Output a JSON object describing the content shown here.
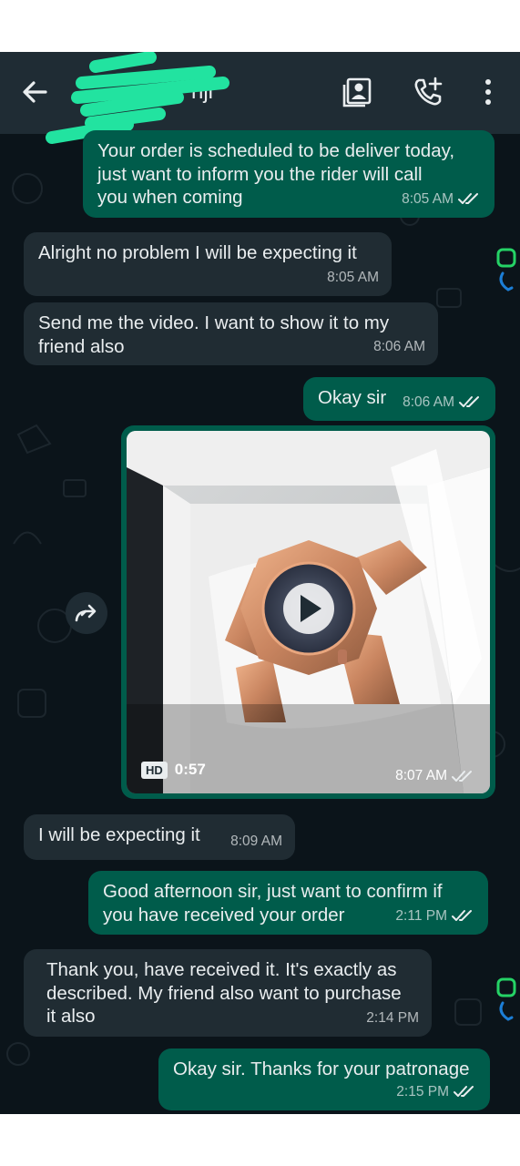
{
  "header": {
    "contact_name": "nji",
    "icons": [
      "back-arrow-icon",
      "contact-card-icon",
      "add-call-icon",
      "more-vert-icon"
    ]
  },
  "messages": [
    {
      "direction": "out",
      "text": "Your order is scheduled to be deliver today,\njust want to inform you the rider will call\nyou when coming",
      "time": "8:05 AM",
      "status": "read"
    },
    {
      "direction": "in",
      "text": "Alright no problem I will be expecting it",
      "time": "8:05 AM"
    },
    {
      "direction": "in",
      "text": "Send me the video. I want to show it to my\nfriend also",
      "time": "8:06 AM"
    },
    {
      "direction": "out",
      "text": "Okay sir",
      "time": "8:06 AM",
      "status": "read"
    },
    {
      "direction": "in",
      "text": "I will be expecting it",
      "time": "8:09 AM"
    },
    {
      "direction": "out",
      "text": "Good afternoon sir, just want to confirm if\nyou have received your order",
      "time": "2:11 PM",
      "status": "read"
    },
    {
      "direction": "in",
      "text": "Thank you, have received it. It's exactly as\ndescribed. My friend also want to purchase\nit also",
      "time": "2:14 PM"
    },
    {
      "direction": "out",
      "text": "Okay sir. Thanks for your patronage",
      "time": "2:15 PM",
      "status": "read"
    }
  ],
  "video": {
    "hd_label": "HD",
    "duration": "0:57",
    "time": "8:07 AM",
    "status": "read"
  },
  "colors": {
    "outgoing_bubble": "#005c4b",
    "incoming_bubble": "#202c33",
    "chat_background": "#0b141a",
    "header": "#1f2c34",
    "read_ticks": "#e9edef"
  }
}
